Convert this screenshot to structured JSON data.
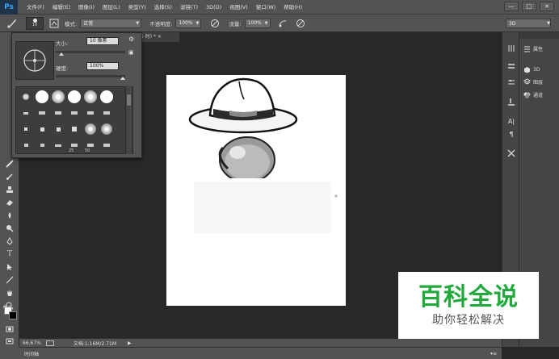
{
  "app": {
    "logo": "Ps"
  },
  "menu": [
    "文件(F)",
    "编辑(E)",
    "图像(I)",
    "图层(L)",
    "类型(Y)",
    "选择(S)",
    "滤镜(T)",
    "3D(D)",
    "视图(V)",
    "窗口(W)",
    "帮助(H)"
  ],
  "window_controls": {
    "minimize": "—",
    "maximize": "□",
    "close": "✕"
  },
  "options": {
    "brush_size": "10",
    "mode_label": "模式:",
    "mode_value": "正常",
    "opacity_label": "不透明度:",
    "opacity_value": "100%",
    "flow_label": "流量:",
    "flow_value": "100%",
    "workspace": "3D"
  },
  "brush_panel": {
    "size_label": "大小:",
    "size_value": "10 像素",
    "hardness_label": "硬度:",
    "hardness_value": "100%",
    "size_fraction": 0.05,
    "hardness_fraction": 1.0,
    "brush_numbers": [
      "25",
      "50"
    ]
  },
  "document": {
    "tab_text": "5 时) * ×"
  },
  "right_panel": {
    "items": [
      {
        "label": "属性",
        "icon": "properties-icon"
      },
      {
        "label": "3D",
        "icon": "3d-icon"
      },
      {
        "label": "图层",
        "icon": "layers-icon"
      },
      {
        "label": "通道",
        "icon": "channels-icon"
      }
    ]
  },
  "status": {
    "zoom": "66.67%",
    "doc_info": "文档:1.16M/2.71M"
  },
  "timeline": {
    "label": "时间轴"
  },
  "watermark": {
    "title": "百科全说",
    "subtitle": "助你轻松解决"
  },
  "colors": {
    "ui_bg": "#535353",
    "dark_bg": "#282828",
    "accent": "#31a8ff",
    "watermark_green": "#22a83c"
  }
}
